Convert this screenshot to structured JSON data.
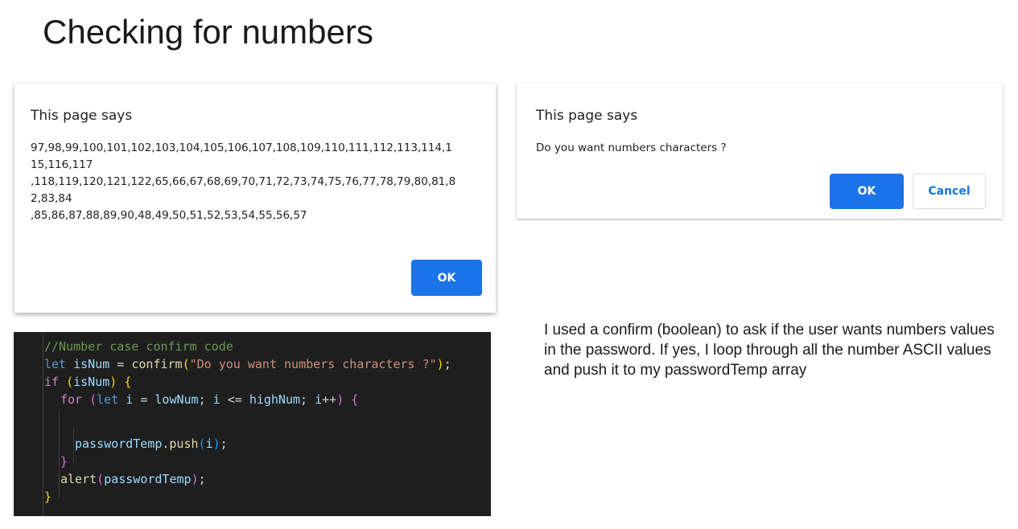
{
  "title": "Checking for numbers",
  "alert_dialog": {
    "heading": "This page says",
    "message": "97,98,99,100,101,102,103,104,105,106,107,108,109,110,111,112,113,114,1\n15,116,117\n,118,119,120,121,122,65,66,67,68,69,70,71,72,73,74,75,76,77,78,79,80,81,8\n2,83,84\n,85,86,87,88,89,90,48,49,50,51,52,53,54,55,56,57",
    "ok_label": "OK"
  },
  "confirm_dialog": {
    "heading": "This page says",
    "message": "Do you want numbers characters ?",
    "ok_label": "OK",
    "cancel_label": "Cancel"
  },
  "code": {
    "comment": "//Number case confirm code",
    "kw_let1": "let",
    "var_isNum1": "isNum",
    "eq1": " = ",
    "fn_confirm": "confirm",
    "paren_open1": "(",
    "str_prompt": "\"Do you want numbers characters ?\"",
    "paren_close1": ")",
    "semi1": ";",
    "kw_if": "if",
    "paren_open2": "(",
    "var_isNum2": "isNum",
    "paren_close2": ")",
    "brace_open1": "{",
    "kw_for": "for",
    "paren_open3": "(",
    "kw_let2": "let",
    "var_i1": "i",
    "eq2": " = ",
    "var_lowNum": "lowNum",
    "semi2": "; ",
    "var_i2": "i",
    "lte": " <= ",
    "var_highNum": "highNum",
    "semi3": "; ",
    "var_i3": "i",
    "incr": "++",
    "paren_close3": ")",
    "brace_open2": "{",
    "var_passwordTemp1": "passwordTemp",
    "dot1": ".",
    "fn_push": "push",
    "paren_open4": "(",
    "var_i4": "i",
    "paren_close4": ")",
    "semi4": ";",
    "brace_close2": "}",
    "fn_alert": "alert",
    "paren_open5": "(",
    "var_passwordTemp2": "passwordTemp",
    "paren_close5": ")",
    "semi5": ";",
    "brace_close1": "}"
  },
  "description": "I used a confirm (boolean) to ask if the user wants numbers values in the password. If yes, I loop through all the number ASCII values and push it to my passwordTemp array",
  "colors": {
    "button_blue": "#1a73e8",
    "code_background": "#1e1e1e"
  }
}
